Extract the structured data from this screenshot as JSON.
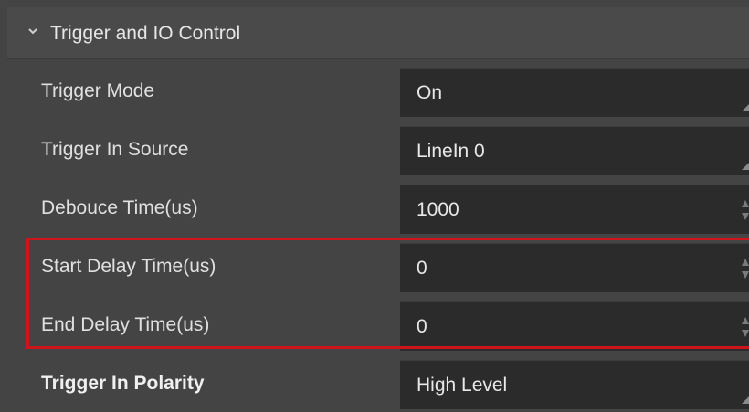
{
  "section": {
    "title": "Trigger and IO Control",
    "expand_icon": "chevron-down-icon"
  },
  "rows": [
    {
      "label": "Trigger Mode",
      "value": "On",
      "control": "dropdown",
      "bold": false
    },
    {
      "label": "Trigger In Source",
      "value": "LineIn 0",
      "control": "dropdown",
      "bold": false
    },
    {
      "label": "Debouce Time(us)",
      "value": "1000",
      "control": "spinbox",
      "bold": false
    },
    {
      "label": "Start Delay Time(us)",
      "value": "0",
      "control": "spinbox",
      "bold": false
    },
    {
      "label": "End Delay Time(us)",
      "value": "0",
      "control": "spinbox",
      "bold": false
    },
    {
      "label": "Trigger In Polarity",
      "value": "High Level",
      "control": "dropdown",
      "bold": true
    }
  ],
  "highlight": {
    "color": "#d0141c",
    "covers_rows": [
      "Start Delay Time(us)",
      "End Delay Time(us)"
    ]
  },
  "colors": {
    "background": "#444444",
    "field_background": "#2b2b2b",
    "text": "#e8e8e8"
  }
}
